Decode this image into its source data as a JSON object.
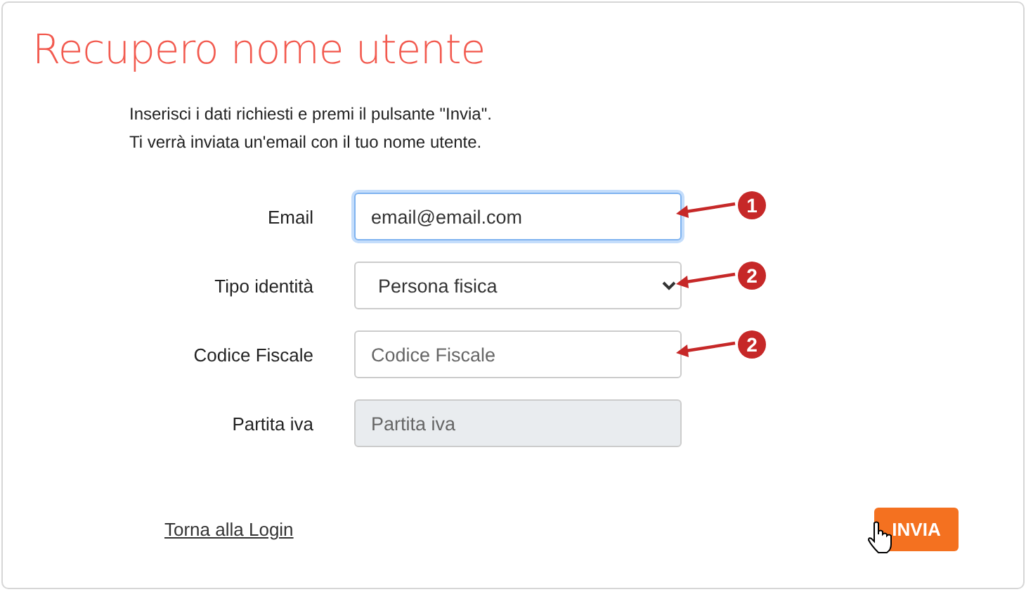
{
  "title": "Recupero nome utente",
  "instructions": [
    "Inserisci i dati richiesti e premi il pulsante \"Invia\".",
    "Ti verrà inviata un'email con il tuo nome utente."
  ],
  "fields": [
    {
      "label": "Email",
      "kind": "input",
      "value": "email@email.com",
      "focused": true,
      "disabled": false,
      "marker": "1"
    },
    {
      "label": "Tipo identità",
      "kind": "select",
      "value": "Persona fisica",
      "focused": false,
      "disabled": false,
      "marker": "2"
    },
    {
      "label": "Codice Fiscale",
      "kind": "input",
      "placeholder": "Codice Fiscale",
      "focused": false,
      "disabled": false,
      "marker": "2"
    },
    {
      "label": "Partita iva",
      "kind": "input",
      "placeholder": "Partita iva",
      "focused": false,
      "disabled": true
    }
  ],
  "back_link": "Torna alla Login",
  "submit_button": "INVIA"
}
